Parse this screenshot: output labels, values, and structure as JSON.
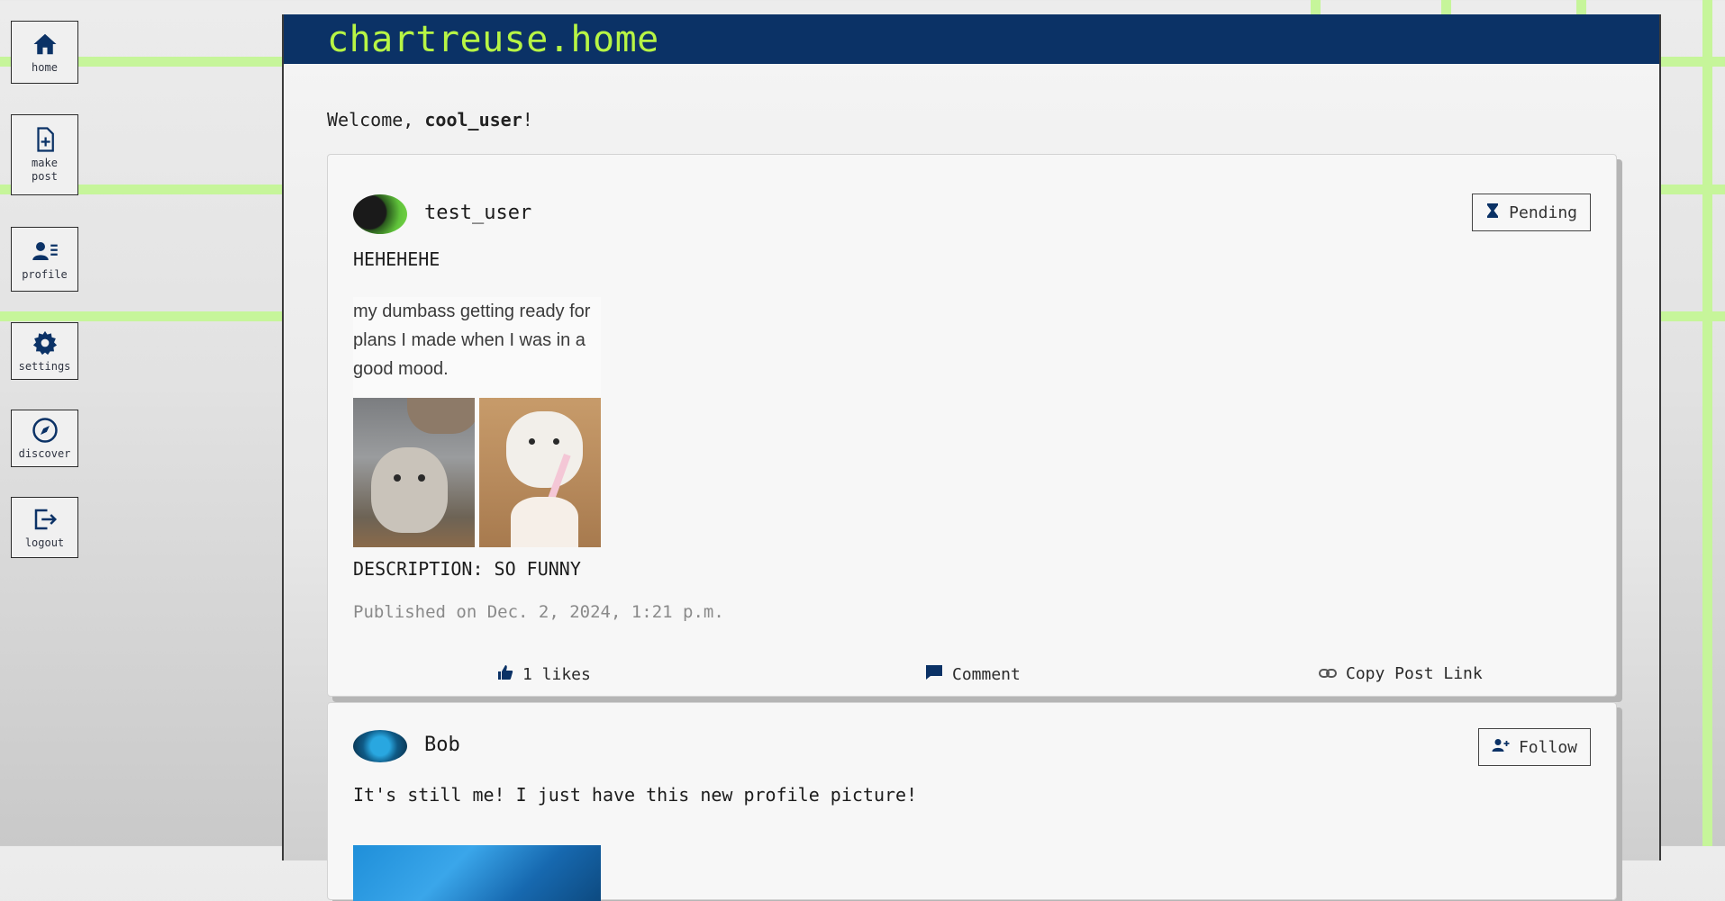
{
  "nav": {
    "home": "home",
    "make_post_line1": "make",
    "make_post_line2": "post",
    "profile": "profile",
    "settings": "settings",
    "discover": "discover",
    "logout": "logout"
  },
  "header": {
    "brand": "chartreuse.home"
  },
  "welcome": {
    "prefix": "Welcome, ",
    "username": "cool_user",
    "suffix": "!"
  },
  "posts": [
    {
      "author": "test_user",
      "status_label": "Pending",
      "status_icon": "hourglass-icon",
      "text": "HEHEHEHE",
      "meme_caption": "my dumbass getting ready for plans I made when I was in a good mood.",
      "description": "DESCRIPTION: SO FUNNY",
      "published": "Published on Dec. 2, 2024, 1:21 p.m.",
      "likes_label": "1 likes",
      "comment_label": "Comment",
      "copy_label": "Copy Post Link"
    },
    {
      "author": "Bob",
      "status_label": "Follow",
      "status_icon": "user-plus-icon",
      "text": "It's still me! I just have this new profile picture!"
    }
  ],
  "colors": {
    "header_bg": "#0b3266",
    "brand": "#b7f545",
    "accent_icon": "#0b3266",
    "grid_lines": "#c6f59a"
  }
}
